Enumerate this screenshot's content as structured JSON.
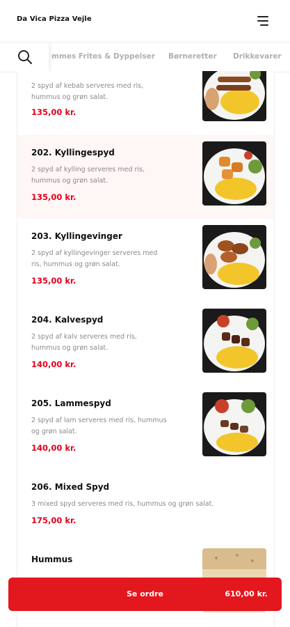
{
  "header": {
    "title": "Da Vica Pizza Vejle"
  },
  "tabs": [
    {
      "label": "mmes Frites & Dyppelser"
    },
    {
      "label": "Børneretter"
    },
    {
      "label": "Drikkevarer"
    }
  ],
  "items": [
    {
      "name": "",
      "desc": "2 spyd af kebab serveres med ris, hummus og grøn salat.",
      "price": "135,00 kr.",
      "image": "kebab-skewer-plate"
    },
    {
      "name": "202. Kyllingespyd",
      "desc": "2 spyd af kylling serveres med ris, hummus og grøn salat.",
      "price": "135,00 kr.",
      "image": "chicken-skewer-plate"
    },
    {
      "name": "203. Kyllingevinger",
      "desc": "2 spyd af kyllingevinger serveres med ris, hummus og grøn salat.",
      "price": "135,00 kr.",
      "image": "chicken-wings-plate"
    },
    {
      "name": "204. Kalvespyd",
      "desc": "2 spyd af kalv serveres med ris, hummus og grøn salat.",
      "price": "140,00 kr.",
      "image": "veal-skewer-plate"
    },
    {
      "name": "205. Lammespyd",
      "desc": "2 spyd af lam serveres med ris, hummus og grøn salat.",
      "price": "140,00 kr.",
      "image": "lamb-skewer-plate"
    },
    {
      "name": "206. Mixed Spyd",
      "desc": "3 mixed spyd serveres med ris, hummus og grøn salat.",
      "price": "175,00 kr.",
      "image": ""
    },
    {
      "name": "Hummus",
      "desc": "",
      "price": "",
      "image": "hummus-bread"
    }
  ],
  "order": {
    "label": "Se ordre",
    "total": "610,00 kr."
  },
  "colors": {
    "accent": "#e3171e",
    "price": "#e3001b"
  }
}
